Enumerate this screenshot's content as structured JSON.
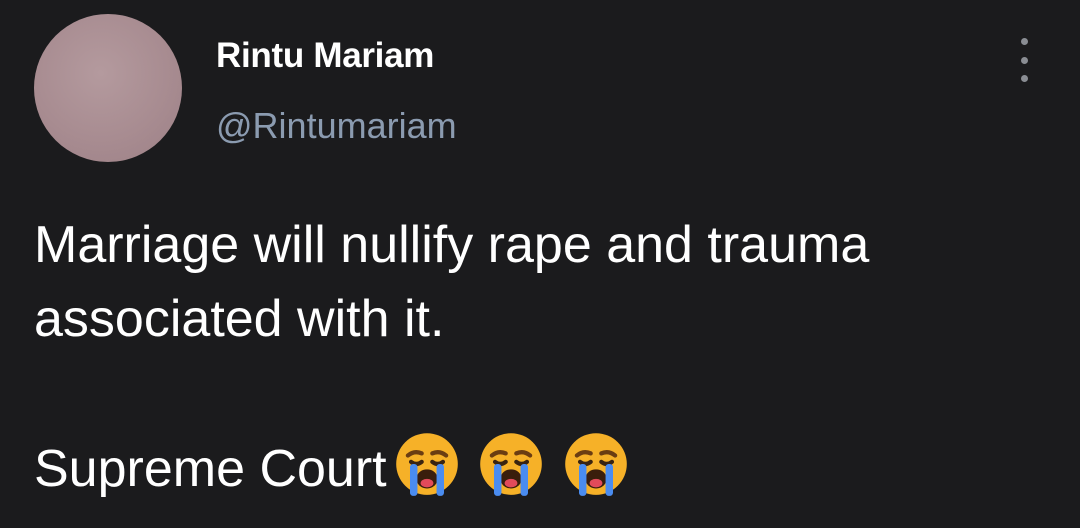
{
  "tweet": {
    "author": {
      "display_name": "Rintu Mariam",
      "handle": "@Rintumariam",
      "avatar_icon": "profile-photo"
    },
    "menu_icon": "more-vertical-icon",
    "text": {
      "line1": "Marriage will nullify rape and trauma",
      "line2": "associated with it.",
      "line3": "Supreme Court"
    },
    "emojis": [
      "loudly-crying-face-icon",
      "loudly-crying-face-icon",
      "loudly-crying-face-icon"
    ]
  },
  "colors": {
    "background": "#1b1b1d",
    "text": "#ffffff",
    "handle": "#8b9bb0",
    "menu_dots": "#8a8d93"
  }
}
